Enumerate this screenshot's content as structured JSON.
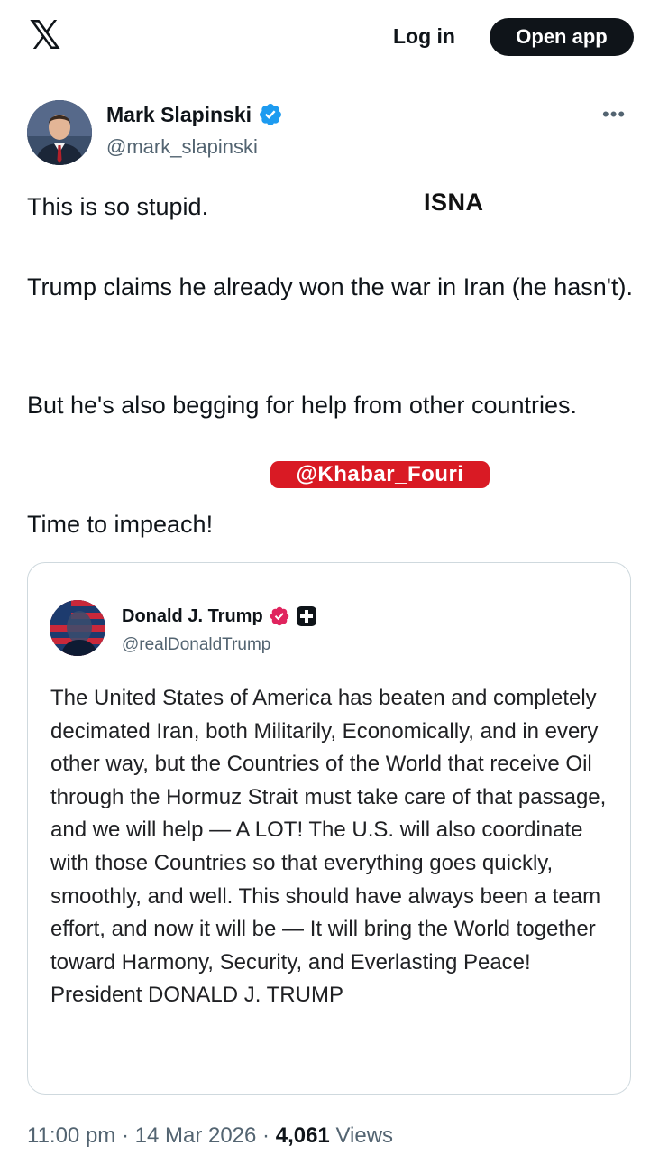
{
  "header": {
    "logo_glyph": "𝕏",
    "login_label": "Log in",
    "open_app_label": "Open app"
  },
  "post": {
    "author_name": "Mark Slapinski",
    "author_handle": "@mark_slapinski",
    "more_glyph": "•••",
    "paragraphs": [
      "This is so stupid.",
      "Trump claims he already won the war in Iran (he hasn't).",
      "But he's also begging for help from other countries.",
      "Time to impeach!"
    ],
    "verified_color": "#1d9bf0"
  },
  "watermarks": {
    "isna": "ISNA",
    "khabar": "@Khabar_Fouri",
    "khabar_color": "#d91a24"
  },
  "quote": {
    "author_name": "Donald J. Trump",
    "author_handle": "@realDonaldTrump",
    "text": "The United States of America has beaten and completely decimated Iran, both Militarily, Economically, and in every other way, but the Countries of the World that receive Oil through the Hormuz Strait must take care of that passage, and we will help — A LOT! The U.S. will also coordinate with those Countries so that everything goes quickly, smoothly, and well. This should have always been a team effort, and now it will be — It will bring the World together toward Harmony, Security, and Everlasting Peace! President DONALD J. TRUMP",
    "badge_color": "#e0245e"
  },
  "meta": {
    "time": "11:00 pm",
    "separator": " · ",
    "date": "14 Mar 2026",
    "views_count": "4,061",
    "views_label": "Views"
  }
}
